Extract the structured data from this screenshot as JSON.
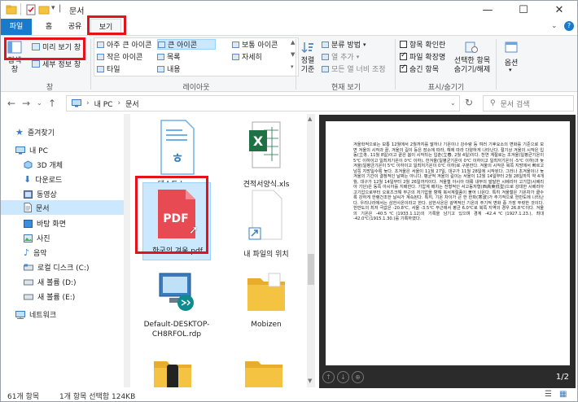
{
  "window": {
    "title": "문서",
    "controls": {
      "minimize": "—",
      "maximize": "☐",
      "close": "✕"
    }
  },
  "tabs": [
    {
      "label": "파일"
    },
    {
      "label": "홈"
    },
    {
      "label": "공유"
    },
    {
      "label": "보기"
    }
  ],
  "ribbon": {
    "pane": {
      "nav_label": "탐색 창",
      "preview_label": "미리 보기 창",
      "details_label": "세부 정보 창",
      "group": "창"
    },
    "layout": {
      "items": [
        "아주 큰 아이콘",
        "큰 아이콘",
        "보통 아이콘",
        "작은 아이콘",
        "목록",
        "자세히",
        "타일",
        "내용"
      ],
      "group": "레이아웃"
    },
    "current_view": {
      "sort_label": "정렬 기준",
      "group_by": "분류 방법",
      "add_column": "열 추가",
      "fit_columns": "모든 열 너비 조정",
      "group": "현재 보기"
    },
    "show_hide": {
      "item_check": "항목 확인란",
      "extensions": "파일 확장명",
      "hidden_items": "숨긴 항목",
      "hide_selected": "선택한 항목 숨기기/해제",
      "group": "표시/숨기기"
    },
    "options": {
      "label": "옵션"
    }
  },
  "address": {
    "path": [
      "내 PC",
      "문서"
    ],
    "search_placeholder": "문서 검색"
  },
  "nav": [
    {
      "label": "즐겨찾기",
      "icon": "star-icon"
    },
    {
      "label": "내 PC",
      "icon": "pc-icon"
    },
    {
      "label": "3D 개체",
      "icon": "cube-icon"
    },
    {
      "label": "다운로드",
      "icon": "download-icon"
    },
    {
      "label": "동영상",
      "icon": "video-icon"
    },
    {
      "label": "문서",
      "icon": "document-icon"
    },
    {
      "label": "바탕 화면",
      "icon": "desktop-icon"
    },
    {
      "label": "사진",
      "icon": "picture-icon"
    },
    {
      "label": "음악",
      "icon": "music-icon"
    },
    {
      "label": "로컬 디스크 (C:)",
      "icon": "drive-icon"
    },
    {
      "label": "새 볼륨 (D:)",
      "icon": "drive-icon"
    },
    {
      "label": "새 볼륨 (E:)",
      "icon": "drive-icon"
    },
    {
      "label": "네트워크",
      "icon": "network-icon"
    }
  ],
  "files": [
    {
      "name": "테스트.hwp",
      "icon": "hwp-icon"
    },
    {
      "name": "견적서양식.xls",
      "icon": "excel-icon"
    },
    {
      "name": "한국의 겨울.pdf",
      "icon": "pdf-icon",
      "type_label": "PDF"
    },
    {
      "name": "내 파일의 위치",
      "icon": "shortcut-icon"
    },
    {
      "name": "Default-DESKTOP-CH8RFOL.rdp",
      "icon": "rdp-icon"
    },
    {
      "name": "Mobizen",
      "icon": "folder-icon"
    }
  ],
  "preview": {
    "text": "겨울학적으로는 보통 12월에서 2월까지를 말하나 기온이나 강수량 등 여러 기후요소의 변화를 기준으로 보면 겨울의 시작과 끝, 겨울의 길이 등은 장소에 따라, 해에 따라 다양하게 나타난다. 절기상 겨울의 시작은 입동(立冬, 11월 8일)이고 끝은 봄이 시작되는 입춘(立春, 2월 4일)이다. 천연 계절로는 초겨울(일평균기온이 5℃ 이하이고 일최저기온이 0℃ 이하), 한겨울(일평균기온이 0℃ 이하이고 일최저기온이 -5℃ 이하)과 늦겨울(일평균기온이 5℃ 이하이고 일최저기온이 0℃ 이하)로 구분한다. 겨울의 시작은 북쪽 지방에서 빠르고 남쪽 지방일수록 늦다. 초겨울은 서울이 11월 27일, 대구가 11월 28일에 시작된다. 그러나 초겨울이나 늦겨울의 기간이 결정적인 날짜는 아니다. 평균적 겨울의 길이는 서울이 12월 14일부터 2월 28일까지 약 4개월, 대구가 12월 14일부터 2월 26일까지이다. 겨울철 아시아 대륙 내부의 발달한 시베리아 고기압(시베리아 기단)은 동쪽 아시아를 지배한다. 기압계 배치는 전형적인 서고동저형(西高東低型)으로 강대한 시베리아 고기압으로부터 오호츠크해 부근의 저기압을 향해 북서계절풍이 불어 나온다. 특히 겨울철은 기온차가 클수록 강하게 한랭건조한 날씨가 계속된다. 특히, 기온 차이가 큰 한 한파(寒波)가 주기적으로 한반도에 나타난다. 우리나라에서는 삼한사온이라고 한다. 삼한사온은 광역적인 기온의 주기적 변화 중 가장 뚜렷한 것이다. 한반도의 최저 극값은 -20.8℃, 서울 -3.5℃ 부근에서 평균 6.0℃로 북쪽 지역의 경우 26.8℃이다. 겨울의 기온은 -40.5℃(1933.1.12)의 기록을 남기고 있으며 경계 -42.4℃(1927.1.23.), 최대 -42.0℃(1915.1.30.)를 기록하였다.",
    "page_indicator": "1/2"
  },
  "status": {
    "count": "61개 항목",
    "selection": "1개 항목 선택함 124KB"
  },
  "colors": {
    "accent": "#1979ca",
    "highlight": "#e4121a",
    "selection": "#cce8ff",
    "pdf": "#e84a54",
    "excel": "#1e7145",
    "folder": "#f5c342"
  }
}
